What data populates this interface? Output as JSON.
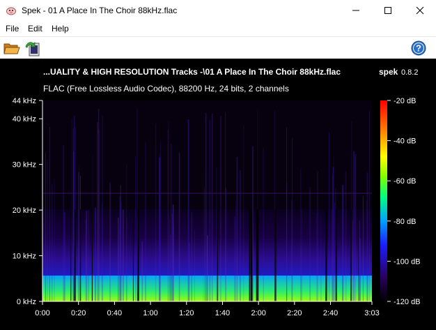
{
  "window": {
    "title": "Spek - 01 A Place In The Choir 88kHz.flac",
    "minimize_glyph": "—",
    "maximize_glyph": "□",
    "close_glyph": "✕"
  },
  "menu": {
    "file": "File",
    "edit": "Edit",
    "help": "Help"
  },
  "toolbar": {
    "open_icon": "folder-open-icon",
    "save_icon": "save-image-icon",
    "help_icon": "help-circle-icon",
    "help_glyph": "?"
  },
  "spectrogram": {
    "file_title": "...UALITY & HIGH RESOLUTION Tracks -\\01 A Place In The Choir 88kHz.flac",
    "app_name": "spek",
    "version": "0.8.2",
    "stream_info": "FLAC (Free Lossless Audio Codec), 88200 Hz, 24 bits, 2 channels",
    "background_color": "#000000",
    "palette": [
      "#000000",
      "#2a0060",
      "#1c1cff",
      "#00a0ff",
      "#00ff80",
      "#80ff00",
      "#ffff00",
      "#ff8000",
      "#ff0000"
    ]
  },
  "chart_data": {
    "type": "heatmap",
    "x_axis": {
      "unit": "time",
      "range": [
        "0:00",
        "3:03"
      ],
      "tick_labels": [
        "0:00",
        "0:20",
        "0:40",
        "1:00",
        "1:20",
        "1:40",
        "2:00",
        "2:20",
        "2:40",
        "3:03"
      ]
    },
    "y_axis": {
      "unit": "kHz",
      "range": [
        0,
        44
      ],
      "tick_labels": [
        "0 kHz",
        "10 kHz",
        "20 kHz",
        "30 kHz",
        "40 kHz",
        "44 kHz"
      ]
    },
    "color_scale": {
      "unit": "dB",
      "range": [
        -120,
        -20
      ],
      "tick_labels": [
        "-20 dB",
        "-40 dB",
        "-60 dB",
        "-80 dB",
        "-100 dB",
        "-120 dB"
      ]
    }
  }
}
